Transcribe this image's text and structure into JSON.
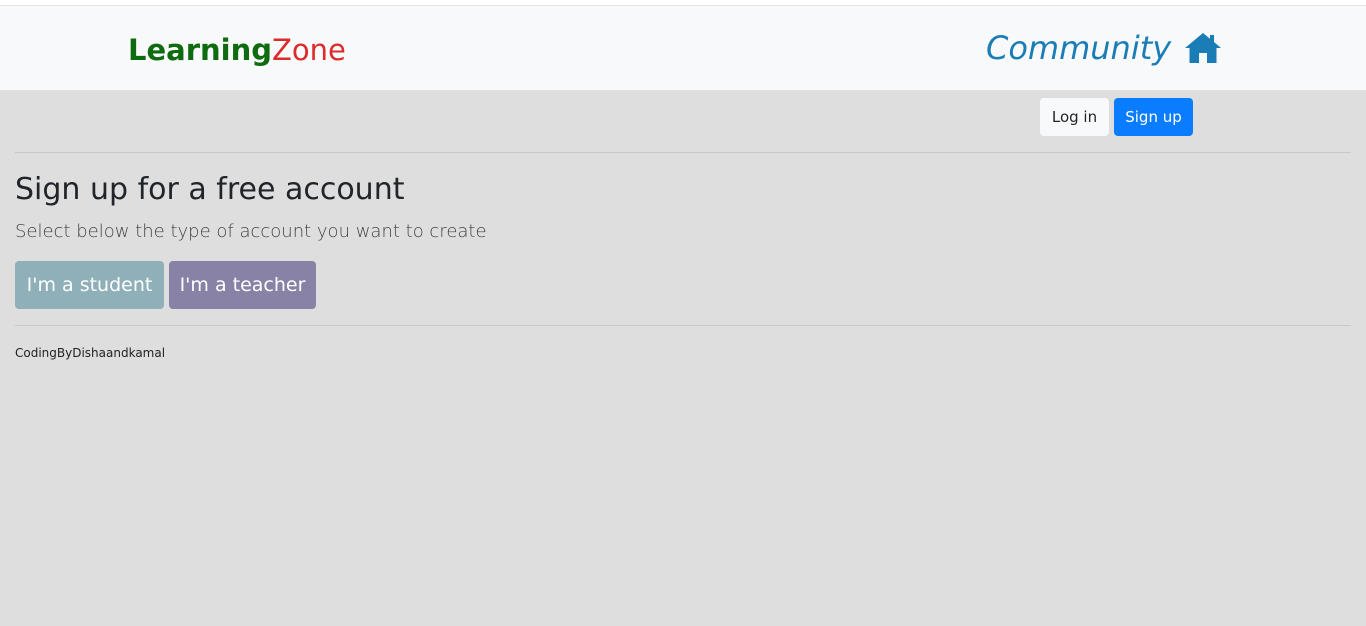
{
  "header": {
    "brand_part1": "Learning",
    "brand_part2": "Zone",
    "community_link": "Community",
    "home_icon": "home-icon"
  },
  "auth": {
    "login_label": "Log in",
    "signup_label": "Sign up"
  },
  "main": {
    "title": "Sign up for a free account",
    "subtitle": "Select below the type of account you want to create",
    "student_button": "I'm a student",
    "teacher_button": "I'm a teacher"
  },
  "footer": {
    "credit": "CodingByDishaandkamal"
  },
  "colors": {
    "brand_primary": "#0f6b0f",
    "brand_accent": "#dc2b2b",
    "link": "#1b7db6",
    "signup": "#0a7cff",
    "student": "#8fb0b9",
    "teacher": "#8782a6",
    "background": "#dedede"
  }
}
